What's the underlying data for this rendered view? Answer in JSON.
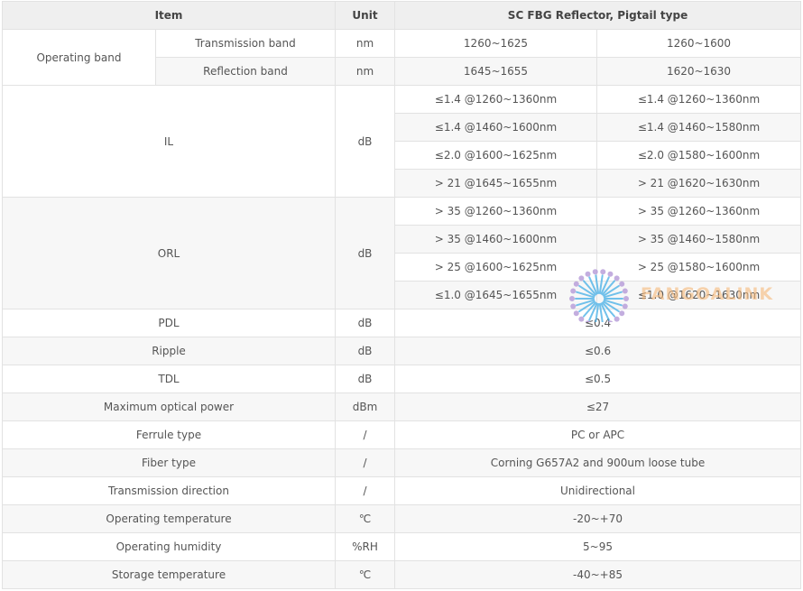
{
  "header": {
    "item": "Item",
    "unit": "Unit",
    "product": "SC FBG Reflector, Pigtail type"
  },
  "operating_band": {
    "label": "Operating band",
    "transmission": {
      "label": "Transmission band",
      "unit": "nm",
      "v1": "1260~1625",
      "v2": "1260~1600"
    },
    "reflection": {
      "label": "Reflection band",
      "unit": "nm",
      "v1": "1645~1655",
      "v2": "1620~1630"
    }
  },
  "il": {
    "label": "IL",
    "unit": "dB",
    "rows": [
      {
        "v1": "≤1.4 @1260~1360nm",
        "v2": "≤1.4 @1260~1360nm"
      },
      {
        "v1": "≤1.4 @1460~1600nm",
        "v2": "≤1.4 @1460~1580nm"
      },
      {
        "v1": "≤2.0 @1600~1625nm",
        "v2": "≤2.0 @1580~1600nm"
      },
      {
        "v1": "> 21 @1645~1655nm",
        "v2": "> 21 @1620~1630nm"
      }
    ]
  },
  "orl": {
    "label": "ORL",
    "unit": "dB",
    "rows": [
      {
        "v1": "> 35 @1260~1360nm",
        "v2": "> 35 @1260~1360nm"
      },
      {
        "v1": "> 35 @1460~1600nm",
        "v2": "> 35 @1460~1580nm"
      },
      {
        "v1": "> 25 @1600~1625nm",
        "v2": "> 25 @1580~1600nm"
      },
      {
        "v1": "≤1.0 @1645~1655nm",
        "v2": "≤1.0 @1620~1630nm"
      }
    ]
  },
  "specs": [
    {
      "label": "PDL",
      "unit": "dB",
      "value": "≤0.4"
    },
    {
      "label": "Ripple",
      "unit": "dB",
      "value": "≤0.6"
    },
    {
      "label": "TDL",
      "unit": "dB",
      "value": "≤0.5"
    },
    {
      "label": "Maximum optical power",
      "unit": "dBm",
      "value": "≤27"
    },
    {
      "label": "Ferrule type",
      "unit": "/",
      "value": "PC or APC"
    },
    {
      "label": "Fiber type",
      "unit": "/",
      "value": "Corning G657A2 and 900um loose tube"
    },
    {
      "label": "Transmission direction",
      "unit": "/",
      "value": "Unidirectional"
    },
    {
      "label": "Operating temperature",
      "unit": "℃",
      "value": "-20~+70"
    },
    {
      "label": "Operating humidity",
      "unit": "%RH",
      "value": "5~95"
    },
    {
      "label": "Storage temperature",
      "unit": "℃",
      "value": "-40~+85"
    }
  ],
  "watermark": {
    "text": "FANGOALINK",
    "color_rays": "#4fb3e8",
    "color_dots": "#b59ad8",
    "color_text": "#f6b978"
  }
}
